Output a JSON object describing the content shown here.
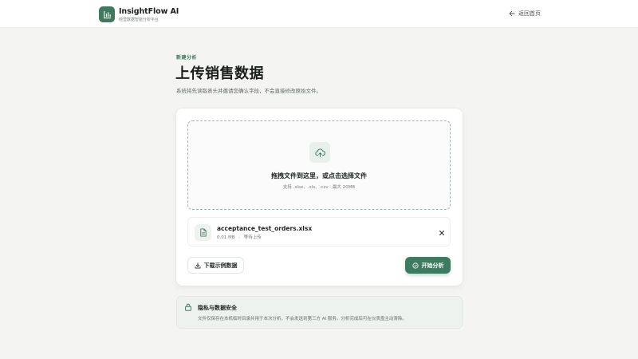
{
  "header": {
    "brand_name": "InsightFlow AI",
    "brand_subtitle": "经营数据智能分析平台",
    "back_label": "返回首页",
    "logo_icon": "bar-chart-icon",
    "back_icon": "arrow-left-icon"
  },
  "intro": {
    "eyebrow": "新建分析",
    "title": "上传销售数据",
    "description": "系统将先读取表头并邀请您确认字段，不会直接修改原始文件。"
  },
  "dropzone": {
    "icon": "cloud-upload-icon",
    "title": "拖拽文件到这里，或点击选择文件",
    "hint": "支持 .xlsx、.xls、.csv · 最大 20MB"
  },
  "file": {
    "icon": "file-icon",
    "name": "acceptance_test_orders.xlsx",
    "size": "0.01 MB",
    "separator": "·",
    "status": "等待上传",
    "remove_icon": "close-icon"
  },
  "actions": {
    "sample_label": "下载示例数据",
    "sample_icon": "download-icon",
    "start_label": "开始分析",
    "start_icon": "check-circle-icon"
  },
  "privacy": {
    "icon": "lock-icon",
    "title": "隐私与数据安全",
    "description": "文件仅保存在本机临时目录并用于本次分析，不会发送到第三方 AI 服务。分析完成后可在仪表盘主动清除。"
  },
  "colors": {
    "accent": "#3e7a5f",
    "background": "#f4f5f3",
    "card": "#ffffff"
  }
}
